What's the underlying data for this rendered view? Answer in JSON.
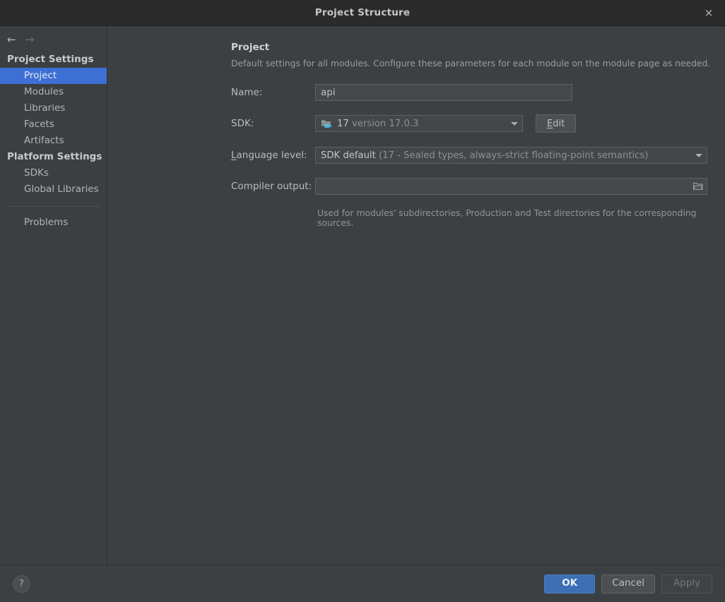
{
  "window": {
    "title": "Project Structure",
    "close_label": "×",
    "close_icon": "close-icon"
  },
  "nav": {
    "back_icon": "arrow-left-icon",
    "back_glyph": "←",
    "forward_icon": "arrow-right-icon",
    "forward_glyph": "→"
  },
  "sidebar": {
    "groups": [
      {
        "title": "Project Settings",
        "items": [
          {
            "label": "Project",
            "selected": true
          },
          {
            "label": "Modules",
            "selected": false
          },
          {
            "label": "Libraries",
            "selected": false
          },
          {
            "label": "Facets",
            "selected": false
          },
          {
            "label": "Artifacts",
            "selected": false
          }
        ]
      },
      {
        "title": "Platform Settings",
        "items": [
          {
            "label": "SDKs",
            "selected": false
          },
          {
            "label": "Global Libraries",
            "selected": false
          }
        ]
      }
    ],
    "extra_items": [
      {
        "label": "Problems",
        "selected": false
      }
    ]
  },
  "main": {
    "section_title": "Project",
    "section_desc": "Default settings for all modules. Configure these parameters for each module on the module page as needed.",
    "name": {
      "label": "Name:",
      "value": "api",
      "placeholder": ""
    },
    "sdk": {
      "label": "SDK:",
      "icon": "java-sdk-folder-icon",
      "version_short": "17",
      "version_full": "version 17.0.3",
      "edit_button": "Edit",
      "edit_mnemonic": "E",
      "edit_rest": "dit"
    },
    "language_level": {
      "label_mnemonic": "L",
      "label_rest": "anguage level:",
      "value_strong": "SDK default",
      "value_dim": "(17 - Sealed types, always-strict floating-point semantics)"
    },
    "compiler_output": {
      "label": "Compiler output:",
      "value": "",
      "placeholder": "",
      "browse_icon": "folder-browse-icon",
      "hint": "Used for modules' subdirectories, Production and Test directories for the corresponding sources."
    }
  },
  "footer": {
    "help_label": "?",
    "help_icon": "help-icon",
    "ok": "OK",
    "cancel": "Cancel",
    "apply": "Apply",
    "apply_disabled": true
  },
  "colors": {
    "accent_selection": "#3d6fd4",
    "primary_button": "#3d6fb5",
    "window_bg": "#3c4043",
    "sidebar_bg": "#3c3f41",
    "titlebar_bg": "#2b2b2b",
    "sdk_icon_cup": "#44b5e0",
    "sdk_icon_folder": "#9aa0a6"
  }
}
